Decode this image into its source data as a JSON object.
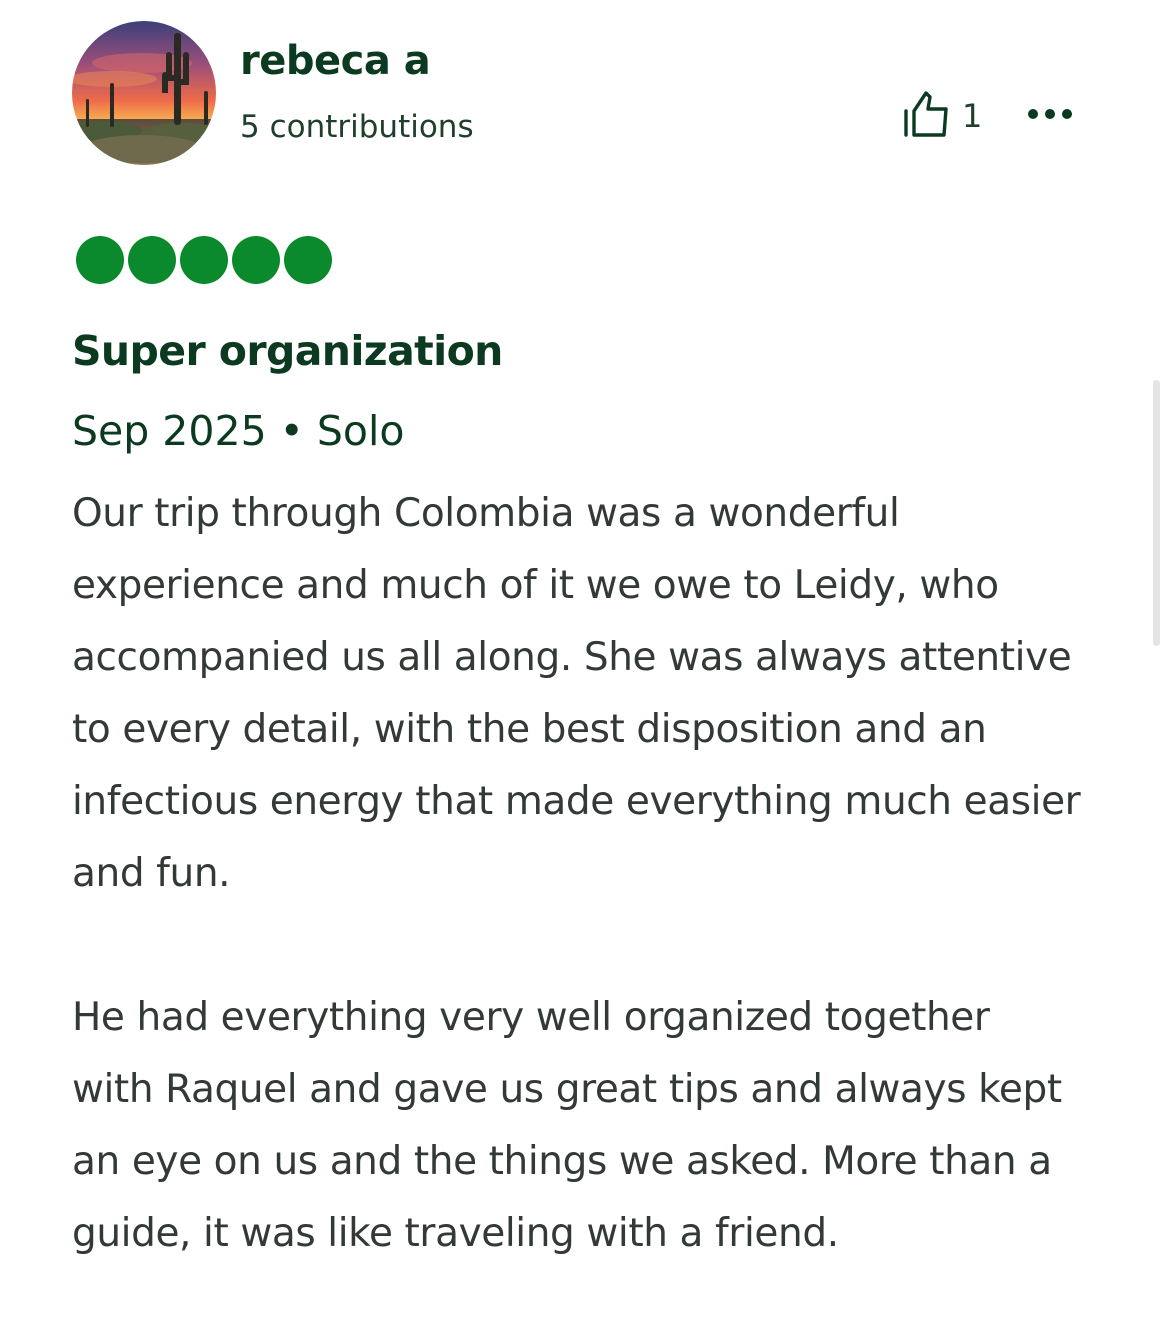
{
  "reviewer": {
    "name": "rebeca a",
    "contributions": "5 contributions",
    "avatar": "saguaro-cactus-sunset-avatar"
  },
  "actions": {
    "helpful_icon": "thumbs-up-icon",
    "helpful_count": "1",
    "more_icon": "more-dots-icon"
  },
  "review": {
    "rating": 5,
    "rating_max": 5,
    "rating_color": "#0a8a2d",
    "title": "Super organization",
    "meta": "Sep 2025 • Solo",
    "paragraphs": [
      "Our trip through Colombia was a wonderful experience and much of it we owe to Leidy, who accompanied us all along. She was always attentive to every detail, with the best disposition and an infectious energy that made everything much easier and fun.",
      "He had everything very well organized together with Raquel and gave us great tips and always kept an eye on us and the things we asked. More than a guide, it was like traveling with a friend."
    ]
  },
  "colors": {
    "heading": "#0b3a20",
    "body_text": "#333a36"
  }
}
